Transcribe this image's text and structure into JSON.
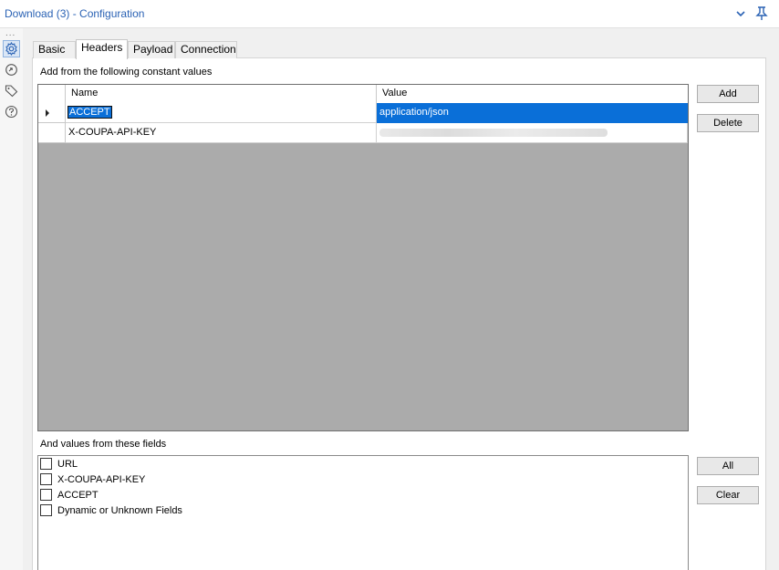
{
  "window": {
    "title": "Download (3) - Configuration",
    "collapse_icon": "chevron-down-icon",
    "pin_icon": "pin-icon"
  },
  "rail": {
    "dots": "...",
    "icons": [
      "gear-icon",
      "refresh-arrow-icon",
      "tag-icon",
      "help-icon"
    ]
  },
  "tabs": [
    {
      "label": "Basic"
    },
    {
      "label": "Headers"
    },
    {
      "label": "Payload"
    },
    {
      "label": "Connection"
    }
  ],
  "headers": {
    "section_label": "Add from the following constant values",
    "columns": [
      "Name",
      "Value"
    ],
    "rows": [
      {
        "name": "ACCEPT",
        "value": "application/json"
      },
      {
        "name": "X-COUPA-API-KEY",
        "value": ""
      }
    ],
    "add_label": "Add",
    "delete_label": "Delete"
  },
  "fields": {
    "section_label": "And values from these fields",
    "items": [
      {
        "label": "URL"
      },
      {
        "label": "X-COUPA-API-KEY"
      },
      {
        "label": "ACCEPT"
      },
      {
        "label": "Dynamic or Unknown Fields"
      }
    ],
    "all_label": "All",
    "clear_label": "Clear"
  },
  "colors": {
    "title_blue": "#2a62b4",
    "selection_blue": "#0a6fd8",
    "grid_background": "#ababab"
  }
}
